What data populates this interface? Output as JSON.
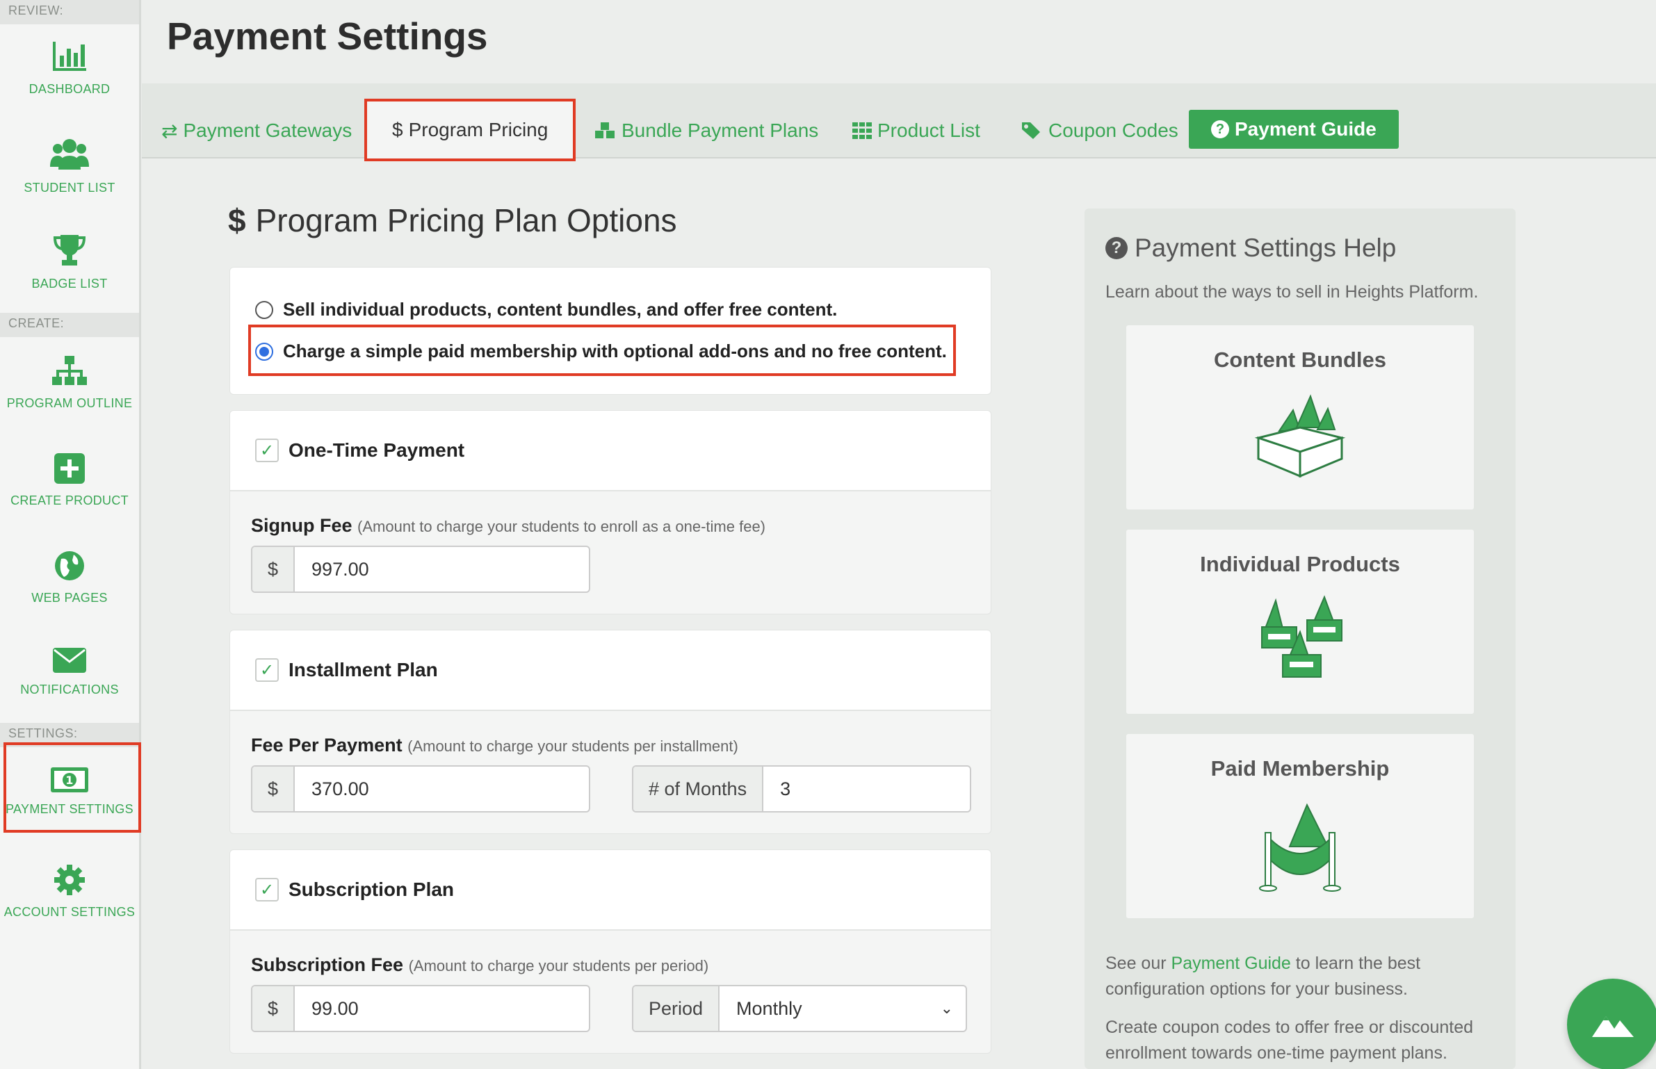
{
  "page_title": "Payment Settings",
  "sidebar": {
    "sections": {
      "review": "REVIEW:",
      "create": "CREATE:",
      "settings": "SETTINGS:"
    },
    "items": [
      {
        "label": "DASHBOARD",
        "icon": "bar-chart-icon"
      },
      {
        "label": "STUDENT LIST",
        "icon": "users-icon"
      },
      {
        "label": "BADGE LIST",
        "icon": "trophy-icon"
      },
      {
        "label": "PROGRAM OUTLINE",
        "icon": "sitemap-icon"
      },
      {
        "label": "CREATE PRODUCT",
        "icon": "plus-square-icon"
      },
      {
        "label": "WEB PAGES",
        "icon": "globe-icon"
      },
      {
        "label": "NOTIFICATIONS",
        "icon": "envelope-icon"
      },
      {
        "label": "PAYMENT SETTINGS",
        "icon": "money-icon"
      },
      {
        "label": "ACCOUNT SETTINGS",
        "icon": "gear-icon"
      }
    ]
  },
  "tabs": [
    {
      "label": "Payment Gateways",
      "icon": "exchange-icon"
    },
    {
      "label": "Program Pricing",
      "icon": "dollar-icon"
    },
    {
      "label": "Bundle Payment Plans",
      "icon": "cubes-icon"
    },
    {
      "label": "Product List",
      "icon": "grid-icon"
    },
    {
      "label": "Coupon Codes",
      "icon": "tags-icon"
    },
    {
      "label": "Payment Guide",
      "icon": "question-circle-icon"
    }
  ],
  "pricing": {
    "title": "Program Pricing Plan Options",
    "options": [
      {
        "label": "Sell individual products, content bundles, and offer free content.",
        "selected": false
      },
      {
        "label": "Charge a simple paid membership with optional add-ons and no free content.",
        "selected": true
      }
    ],
    "one_time": {
      "label": "One-Time Payment",
      "checked": true,
      "field_label": "Signup Fee",
      "field_hint": "(Amount to charge your students to enroll as a one-time fee)",
      "currency": "$",
      "value": "997.00"
    },
    "installment": {
      "label": "Installment Plan",
      "checked": true,
      "field_label": "Fee Per Payment",
      "field_hint": "(Amount to charge your students per installment)",
      "currency": "$",
      "value": "370.00",
      "months_label": "# of Months",
      "months_value": "3"
    },
    "subscription": {
      "label": "Subscription Plan",
      "checked": true,
      "field_label": "Subscription Fee",
      "field_hint": "(Amount to charge your students per period)",
      "currency": "$",
      "value": "99.00",
      "period_label": "Period",
      "period_value": "Monthly"
    }
  },
  "help": {
    "title": "Payment Settings Help",
    "intro": "Learn about the ways to sell in Heights Platform.",
    "cards": [
      "Content Bundles",
      "Individual Products",
      "Paid Membership"
    ],
    "guide_prefix": "See our ",
    "guide_link": "Payment Guide",
    "guide_suffix": " to learn the best configuration options for your business.",
    "coupon_text": "Create coupon codes to offer free or discounted enrollment towards one-time payment plans."
  },
  "colors": {
    "accent": "#3aa655",
    "highlight": "#e03b24",
    "radio": "#2f6fe0"
  }
}
